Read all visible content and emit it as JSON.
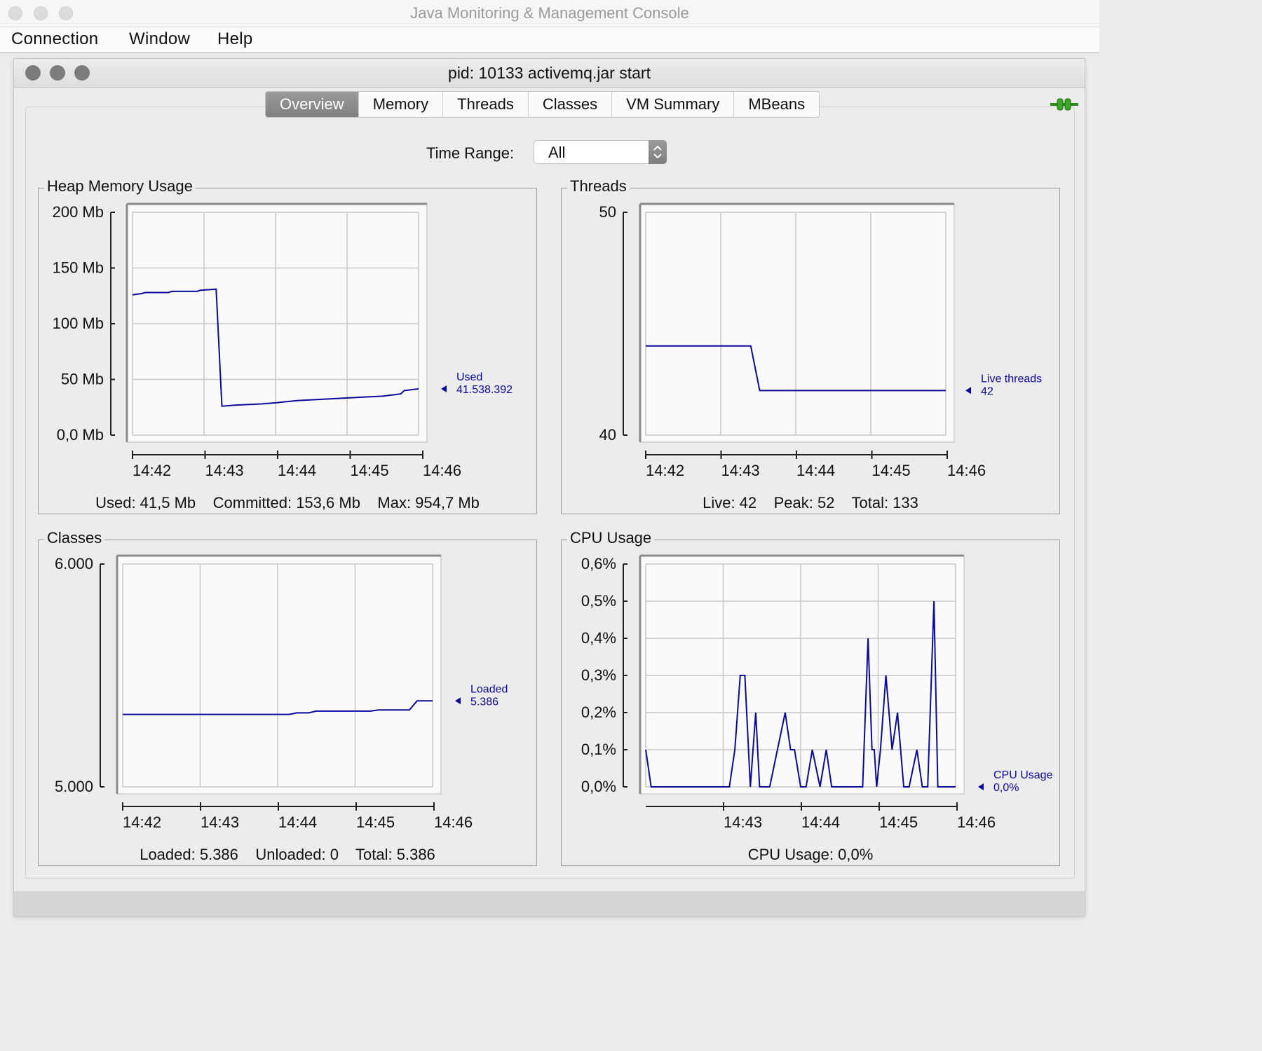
{
  "window": {
    "title": "Java Monitoring & Management Console",
    "menu": [
      "Connection",
      "Window",
      "Help"
    ]
  },
  "inner": {
    "title": "pid: 10133 activemq.jar start",
    "tabs": [
      "Overview",
      "Memory",
      "Threads",
      "Classes",
      "VM Summary",
      "MBeans"
    ],
    "active_tab": "Overview",
    "time_range_label": "Time Range:",
    "time_range_value": "All"
  },
  "panels": {
    "heap": {
      "title": "Heap Memory Usage",
      "summary": "Used: 41,5 Mb    Committed: 153,6 Mb    Max: 954,7 Mb"
    },
    "threads": {
      "title": "Threads",
      "summary": "Live: 42    Peak: 52    Total: 133"
    },
    "classes": {
      "title": "Classes",
      "summary": "Loaded: 5.386    Unloaded: 0    Total: 5.386"
    },
    "cpu": {
      "title": "CPU Usage",
      "summary": "CPU Usage: 0,0%"
    }
  },
  "colors": {
    "series": "#0a0a9a",
    "grid": "#c8c8c8",
    "plot_bg": "#fafafa"
  },
  "chart_data": [
    {
      "id": "heap",
      "type": "line",
      "ylim": [
        0,
        200
      ],
      "ytick_values": [
        0,
        50,
        100,
        150,
        200
      ],
      "ytick_labels": [
        "0,0 Mb",
        "50 Mb",
        "100 Mb",
        "150 Mb",
        "200 Mb"
      ],
      "xlim": [
        0,
        4
      ],
      "xtick_values": [
        0,
        1,
        2,
        3,
        4
      ],
      "xtick_labels": [
        "14:42",
        "14:43",
        "14:44",
        "14:45",
        "14:46"
      ],
      "series": [
        {
          "name": "Used",
          "value_label": "41.538.392",
          "x": [
            0,
            0.12,
            0.18,
            0.5,
            0.55,
            0.9,
            0.95,
            1.17,
            1.25,
            1.45,
            1.8,
            2.0,
            2.3,
            2.6,
            2.9,
            3.2,
            3.5,
            3.75,
            3.8,
            4.0
          ],
          "y": [
            126,
            127,
            128,
            128,
            129,
            129,
            130,
            131,
            26,
            27,
            28,
            29,
            31,
            32,
            33,
            34,
            35,
            37,
            40,
            41.5
          ]
        }
      ]
    },
    {
      "id": "threads",
      "type": "line",
      "ylim": [
        40,
        50
      ],
      "ytick_values": [
        40,
        50
      ],
      "ytick_labels": [
        "40",
        "50"
      ],
      "xlim": [
        0,
        4
      ],
      "xtick_values": [
        0,
        1,
        2,
        3,
        4
      ],
      "xtick_labels": [
        "14:42",
        "14:43",
        "14:44",
        "14:45",
        "14:46"
      ],
      "series": [
        {
          "name": "Live threads",
          "value_label": "42",
          "x": [
            0,
            1.4,
            1.52,
            4.0
          ],
          "y": [
            44,
            44,
            42,
            42
          ]
        }
      ]
    },
    {
      "id": "classes",
      "type": "line",
      "ylim": [
        5000,
        6000
      ],
      "ytick_values": [
        5000,
        6000
      ],
      "ytick_labels": [
        "5.000",
        "6.000"
      ],
      "xlim": [
        0,
        4
      ],
      "xtick_values": [
        0,
        1,
        2,
        3,
        4
      ],
      "xtick_labels": [
        "14:42",
        "14:43",
        "14:44",
        "14:45",
        "14:46"
      ],
      "series": [
        {
          "name": "Loaded",
          "value_label": "5.386",
          "x": [
            0,
            2.15,
            2.25,
            2.4,
            2.5,
            3.2,
            3.3,
            3.7,
            3.8,
            4.0
          ],
          "y": [
            5325,
            5325,
            5332,
            5332,
            5340,
            5340,
            5345,
            5345,
            5386,
            5386
          ]
        }
      ]
    },
    {
      "id": "cpu",
      "type": "line",
      "ylim": [
        0,
        0.6
      ],
      "ytick_values": [
        0,
        0.1,
        0.2,
        0.3,
        0.4,
        0.5,
        0.6
      ],
      "ytick_labels": [
        "0,0%",
        "0,1%",
        "0,2%",
        "0,3%",
        "0,4%",
        "0,5%",
        "0,6%"
      ],
      "xlim": [
        0,
        4
      ],
      "xtick_values": [
        1,
        2,
        3,
        4
      ],
      "xtick_labels": [
        "14:43",
        "14:44",
        "14:45",
        "14:46"
      ],
      "series": [
        {
          "name": "CPU Usage",
          "value_label": "0,0%",
          "x": [
            0,
            0.07,
            1.08,
            1.15,
            1.22,
            1.28,
            1.35,
            1.42,
            1.47,
            1.6,
            1.8,
            1.87,
            1.92,
            2.0,
            2.07,
            2.15,
            2.25,
            2.33,
            2.4,
            2.6,
            2.8,
            2.87,
            2.92,
            2.95,
            2.98,
            3.03,
            3.1,
            3.18,
            3.25,
            3.33,
            3.4,
            3.5,
            3.57,
            3.64,
            3.72,
            3.77,
            3.83,
            4.0
          ],
          "y": [
            0.1,
            0,
            0,
            0.1,
            0.3,
            0.3,
            0,
            0.2,
            0,
            0,
            0.2,
            0.1,
            0.1,
            0,
            0,
            0.1,
            0,
            0.1,
            0,
            0,
            0,
            0.4,
            0.1,
            0.1,
            0,
            0.1,
            0.3,
            0.1,
            0.2,
            0,
            0,
            0.1,
            0,
            0,
            0.5,
            0,
            0,
            0
          ]
        }
      ]
    }
  ]
}
